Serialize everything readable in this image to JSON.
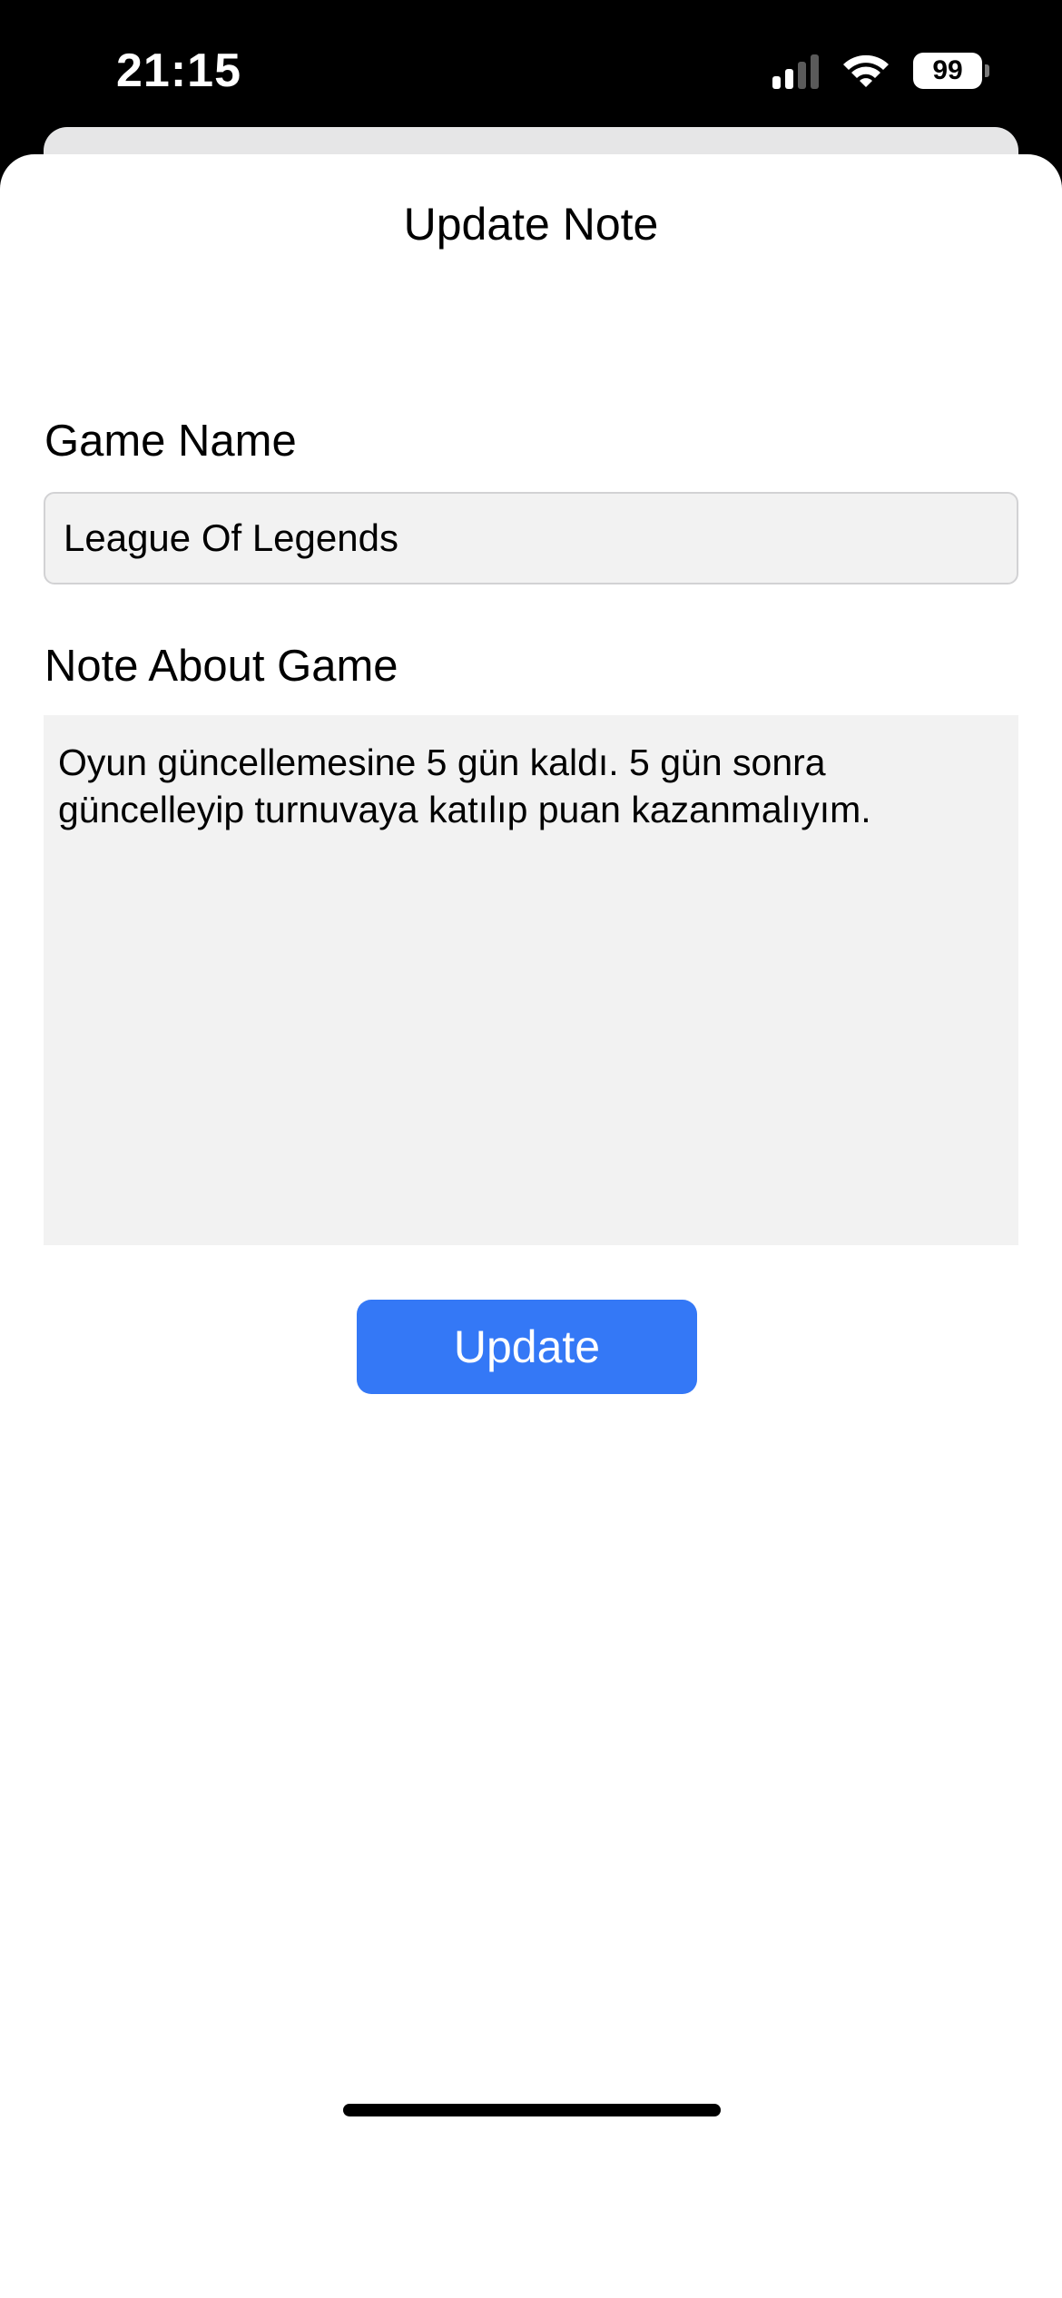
{
  "status_bar": {
    "time": "21:15",
    "battery_level": "99",
    "signal_bars": 2,
    "signal_bars_total": 4,
    "icons": [
      "signal-icon",
      "wifi-icon",
      "battery-icon"
    ]
  },
  "sheet": {
    "title": "Update Note"
  },
  "form": {
    "game_name_label": "Game Name",
    "game_name_value": "League Of Legends",
    "note_label": "Note About Game",
    "note_value": "Oyun güncellemesine 5 gün kaldı. 5 gün sonra güncelleyip turnuvaya katılıp puan kazanmalıyım.",
    "update_button_label": "Update"
  },
  "colors": {
    "accent": "#3478f6",
    "field_background": "#f2f2f2",
    "status_bar_background": "#000000"
  }
}
